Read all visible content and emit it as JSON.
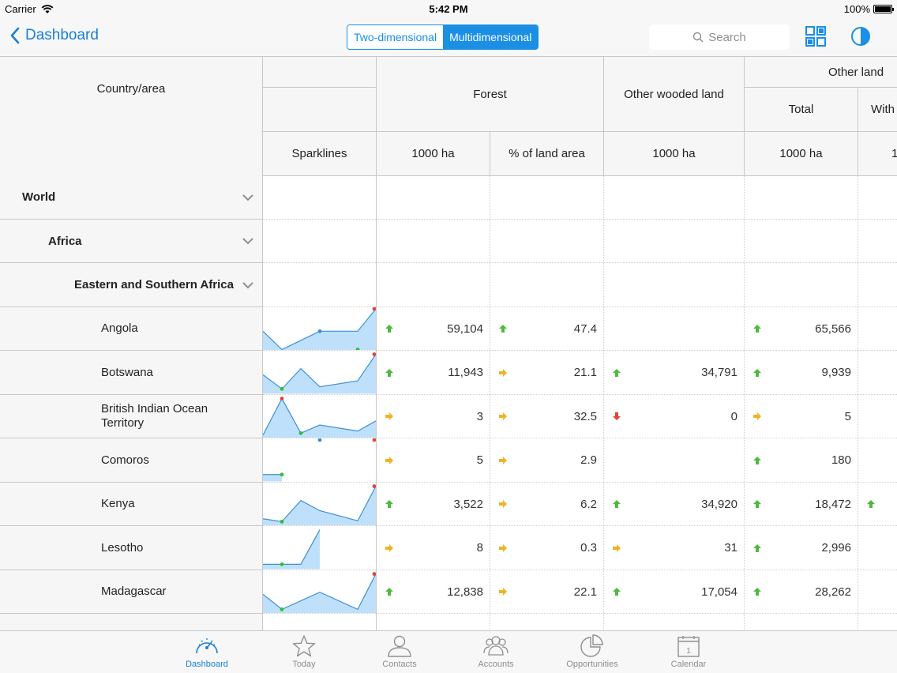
{
  "status": {
    "carrier": "Carrier",
    "time": "5:42 PM",
    "battery": "100%"
  },
  "nav": {
    "back_label": "Dashboard",
    "segments": [
      "Two-dimensional",
      "Multidimensional"
    ],
    "active_segment": 1,
    "search_placeholder": "Search"
  },
  "table": {
    "col_country": "Country/area",
    "col_sparklines": "Sparklines",
    "col_forest": "Forest",
    "col_forest_ha": "1000 ha",
    "col_forest_pct": "% of land area",
    "col_owl": "Other wooded land",
    "col_owl_ha": "1000 ha",
    "col_other": "Other land",
    "col_other_total": "Total",
    "col_other_total_ha": "1000 ha",
    "col_other_with": "With",
    "col_other_with_unit": "1",
    "groups": [
      {
        "label": "World",
        "level": 0
      },
      {
        "label": "Africa",
        "level": 1
      },
      {
        "label": "Eastern and Southern Africa",
        "level": 2
      }
    ],
    "rows": [
      {
        "name": "Angola",
        "forest_ha": "59,104",
        "forest_ha_trend": "up",
        "forest_pct": "47.4",
        "forest_pct_trend": "up",
        "owl": "",
        "owl_trend": "",
        "other_total": "65,566",
        "other_total_trend": "up",
        "with_trend": ""
      },
      {
        "name": "Botswana",
        "forest_ha": "11,943",
        "forest_ha_trend": "up",
        "forest_pct": "21.1",
        "forest_pct_trend": "flat",
        "owl": "34,791",
        "owl_trend": "up",
        "other_total": "9,939",
        "other_total_trend": "up",
        "with_trend": ""
      },
      {
        "name": "British Indian Ocean Territory",
        "forest_ha": "3",
        "forest_ha_trend": "flat",
        "forest_pct": "32.5",
        "forest_pct_trend": "flat",
        "owl": "0",
        "owl_trend": "down",
        "other_total": "5",
        "other_total_trend": "flat",
        "with_trend": ""
      },
      {
        "name": "Comoros",
        "forest_ha": "5",
        "forest_ha_trend": "flat",
        "forest_pct": "2.9",
        "forest_pct_trend": "flat",
        "owl": "",
        "owl_trend": "",
        "other_total": "180",
        "other_total_trend": "up",
        "with_trend": ""
      },
      {
        "name": "Kenya",
        "forest_ha": "3,522",
        "forest_ha_trend": "up",
        "forest_pct": "6.2",
        "forest_pct_trend": "flat",
        "owl": "34,920",
        "owl_trend": "up",
        "other_total": "18,472",
        "other_total_trend": "up",
        "with_trend": "up"
      },
      {
        "name": "Lesotho",
        "forest_ha": "8",
        "forest_ha_trend": "flat",
        "forest_pct": "0.3",
        "forest_pct_trend": "flat",
        "owl": "31",
        "owl_trend": "flat",
        "other_total": "2,996",
        "other_total_trend": "up",
        "with_trend": ""
      },
      {
        "name": "Madagascar",
        "forest_ha": "12,838",
        "forest_ha_trend": "up",
        "forest_pct": "22.1",
        "forest_pct_trend": "flat",
        "owl": "17,054",
        "owl_trend": "up",
        "other_total": "28,262",
        "other_total_trend": "up",
        "with_trend": ""
      }
    ]
  },
  "tabs": [
    {
      "label": "Dashboard",
      "icon": "gauge-icon",
      "active": true
    },
    {
      "label": "Today",
      "icon": "star-icon",
      "active": false
    },
    {
      "label": "Contacts",
      "icon": "person-icon",
      "active": false
    },
    {
      "label": "Accounts",
      "icon": "group-icon",
      "active": false
    },
    {
      "label": "Opportunities",
      "icon": "pie-icon",
      "active": false
    },
    {
      "label": "Calendar",
      "icon": "calendar-icon",
      "active": false,
      "badge": "1"
    }
  ],
  "colors": {
    "accent": "#1a8fe3",
    "up": "#4cbb3c",
    "flat": "#f0b323",
    "down": "#e2433a",
    "spark_fill": "#bfe0fb",
    "spark_line": "#3d8fd6"
  }
}
